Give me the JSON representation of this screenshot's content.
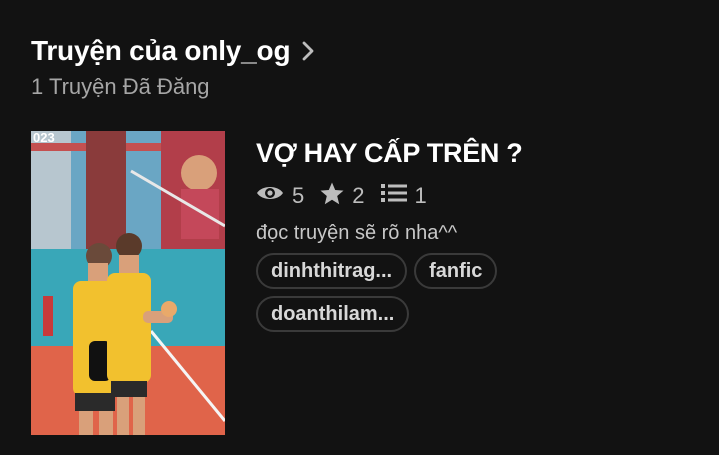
{
  "header": {
    "title": "Truyện của only_og",
    "subtitle": "1 Truyện Đã Đăng"
  },
  "story": {
    "title": "VỢ HAY CẤP TRÊN ?",
    "reads": "5",
    "votes": "2",
    "parts": "1",
    "description": "đọc truyện sẽ rõ nha^^",
    "tags": [
      "dinhthitrag...",
      "fanfic",
      "doanthilam..."
    ],
    "cover_score_text": "023"
  }
}
